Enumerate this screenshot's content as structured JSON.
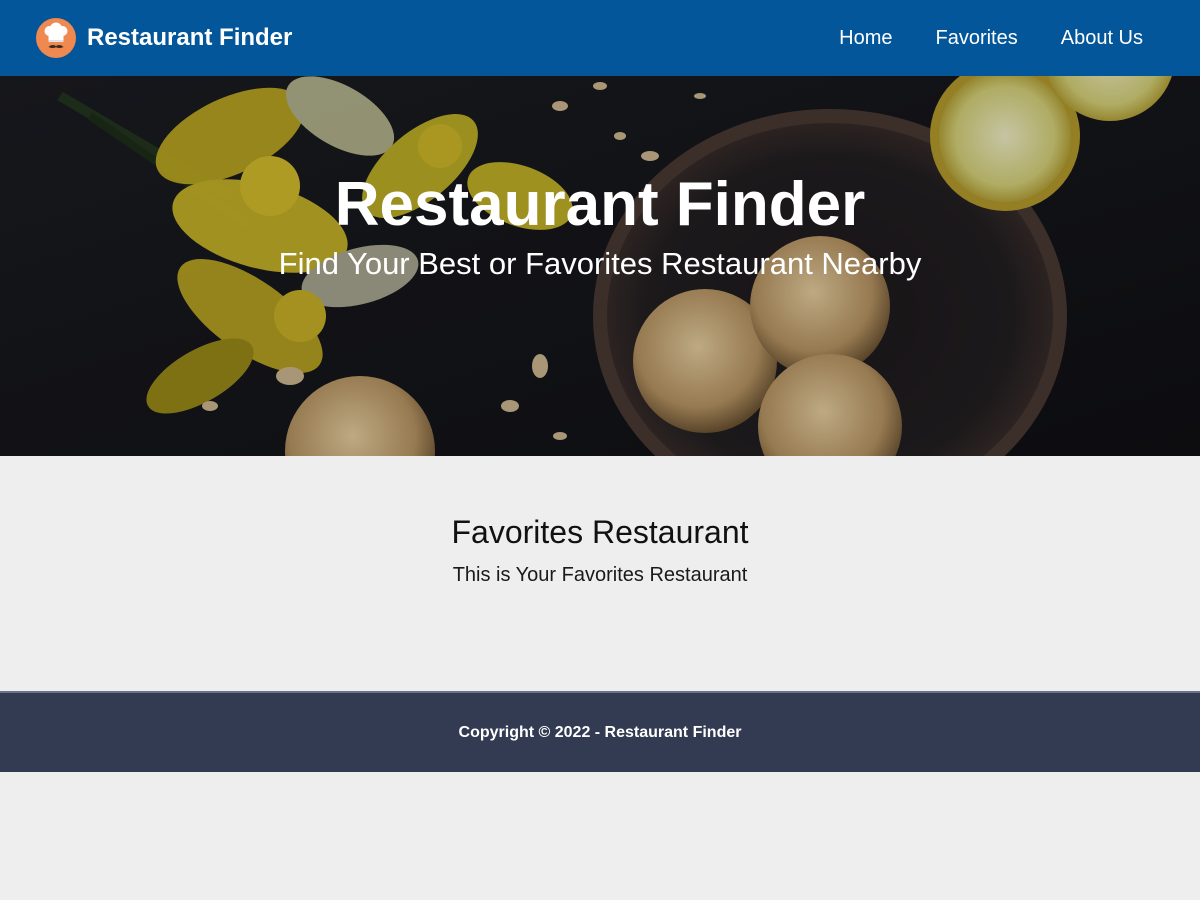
{
  "navbar": {
    "brand": "Restaurant Finder",
    "logo_icon": "chef-logo-icon",
    "links": [
      {
        "label": "Home"
      },
      {
        "label": "Favorites"
      },
      {
        "label": "About Us"
      }
    ],
    "background_color": "#04569a"
  },
  "hero": {
    "title": "Restaurant Finder",
    "subtitle": "Find Your Best or Favorites Restaurant Nearby"
  },
  "main": {
    "title": "Favorites Restaurant",
    "subtitle": "This is Your Favorites Restaurant"
  },
  "footer": {
    "text": "Copyright © 2022 - Restaurant Finder",
    "background_color": "#323b52"
  }
}
